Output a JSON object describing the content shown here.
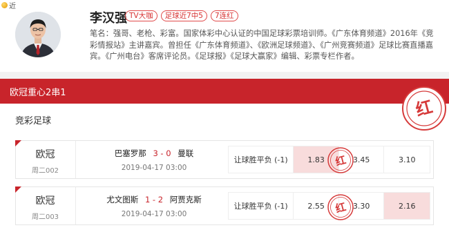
{
  "brand": {
    "label": "近"
  },
  "profile": {
    "name": "李汉强",
    "tags": [
      "TV大咖",
      "足球近7中5",
      "7连红"
    ],
    "bio": "笔名：强哥、老枪、彩富。国家体彩中心认证的中国足球彩票培训师。《广东体育频道》2016年《竞彩情报站》主讲嘉宾。曾担任《广东体育频道》、《欧洲足球频道》、《广州竞赛频道》足球比赛直播嘉宾。《广州电台》客席评论员。《足球报》《足球大赢家》编辑、彩票专栏作者。"
  },
  "banner": {
    "title": "欧冠重心2串1"
  },
  "section": {
    "title": "竞彩足球"
  },
  "stamp": {
    "char": "红",
    "color": "#d63a3a"
  },
  "matches": [
    {
      "league": "欧冠",
      "code": "周二002",
      "home": "巴塞罗那",
      "score": "3 - 0",
      "away": "曼联",
      "time": "2019-04-17 03:00",
      "bet_type": "让球胜平负 (-1)",
      "odds": [
        "1.83",
        "3.45",
        "3.10"
      ],
      "picked_index": 0
    },
    {
      "league": "欧冠",
      "code": "周二003",
      "home": "尤文图斯",
      "score": "1 - 2",
      "away": "阿贾克斯",
      "time": "2019-04-17 03:00",
      "bet_type": "让球胜平负 (-1)",
      "odds": [
        "2.55",
        "3.30",
        "2.16"
      ],
      "picked_index": 2
    }
  ],
  "colors": {
    "accent": "#c8242b",
    "highlight": "#f8dcdc"
  }
}
